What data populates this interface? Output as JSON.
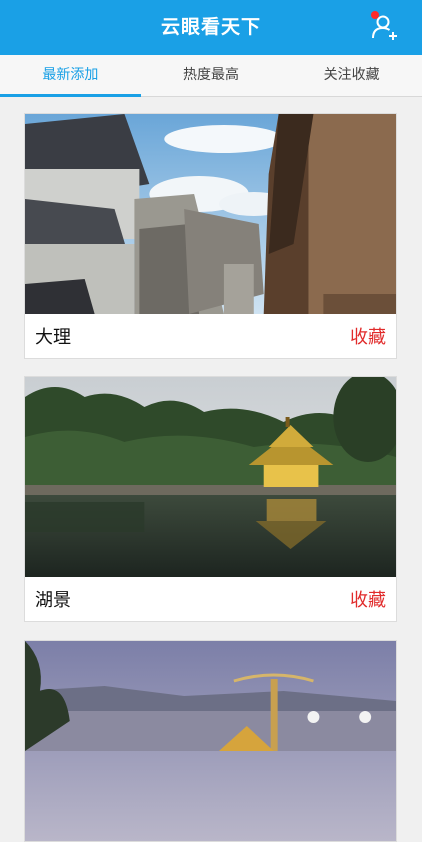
{
  "header": {
    "title": "云眼看天下",
    "user_icon": "user-add-icon",
    "accent": "#1aa0e6",
    "badge_color": "#ff2a2a"
  },
  "tabs": [
    {
      "label": "最新添加",
      "active": true
    },
    {
      "label": "热度最高",
      "active": false
    },
    {
      "label": "关注收藏",
      "active": false
    }
  ],
  "cards": [
    {
      "name": "大理",
      "action": "收藏"
    },
    {
      "name": "湖景",
      "action": "收藏"
    },
    {
      "name": "",
      "action": ""
    }
  ]
}
